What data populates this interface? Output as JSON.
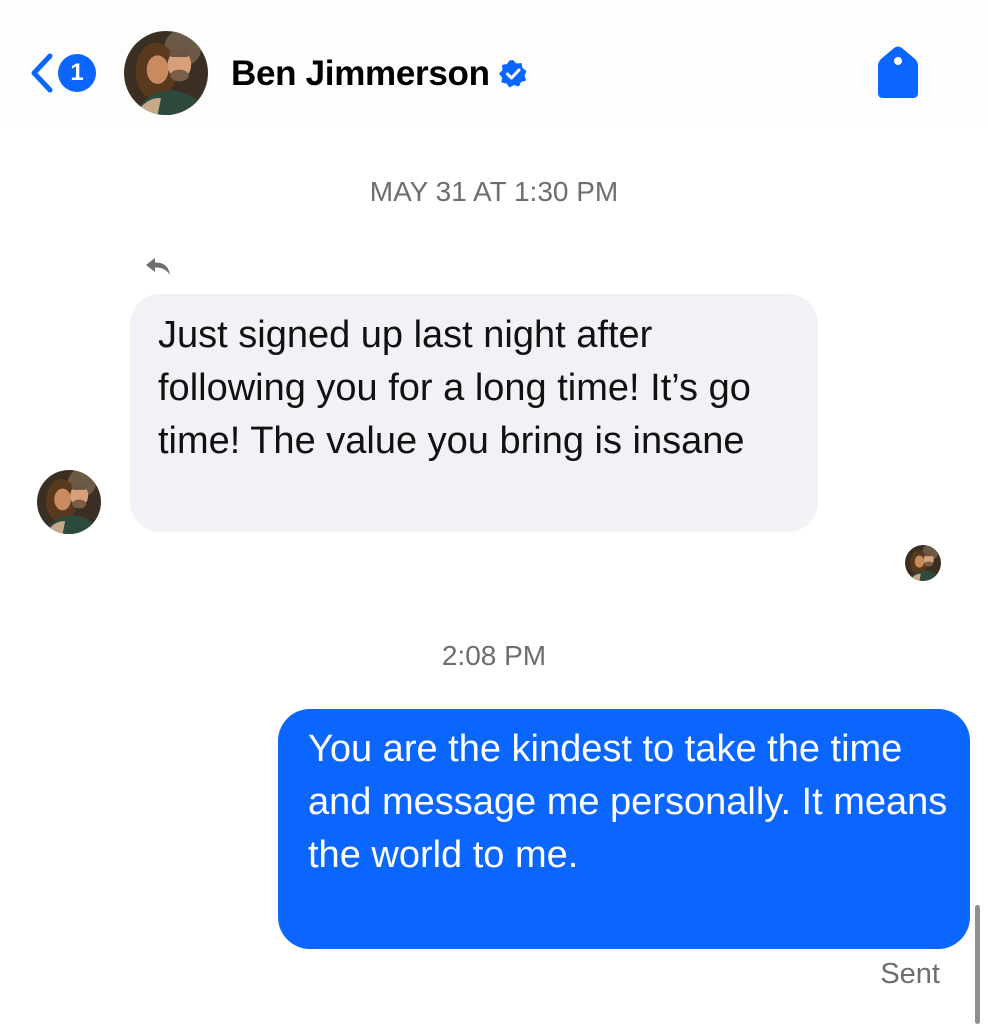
{
  "header": {
    "back_count": "1",
    "contact_name": "Ben Jimmerson",
    "verified": true,
    "accent_color": "#0a66ff",
    "icons": [
      "chevron-left-icon",
      "verified-icon",
      "tag-icon"
    ]
  },
  "conversation": {
    "timestamp_1": "MAY 31 AT 1:30 PM",
    "incoming_message": "Just signed up last night after following you for a long time! It’s go time! The value you bring is insane",
    "timestamp_2": "2:08 PM",
    "outgoing_message": "You are the kindest to take the time and message me personally. It means the world to me.",
    "status": "Sent",
    "incoming_bubble_color": "#f1f2f6",
    "outgoing_bubble_color": "#0a66ff"
  }
}
